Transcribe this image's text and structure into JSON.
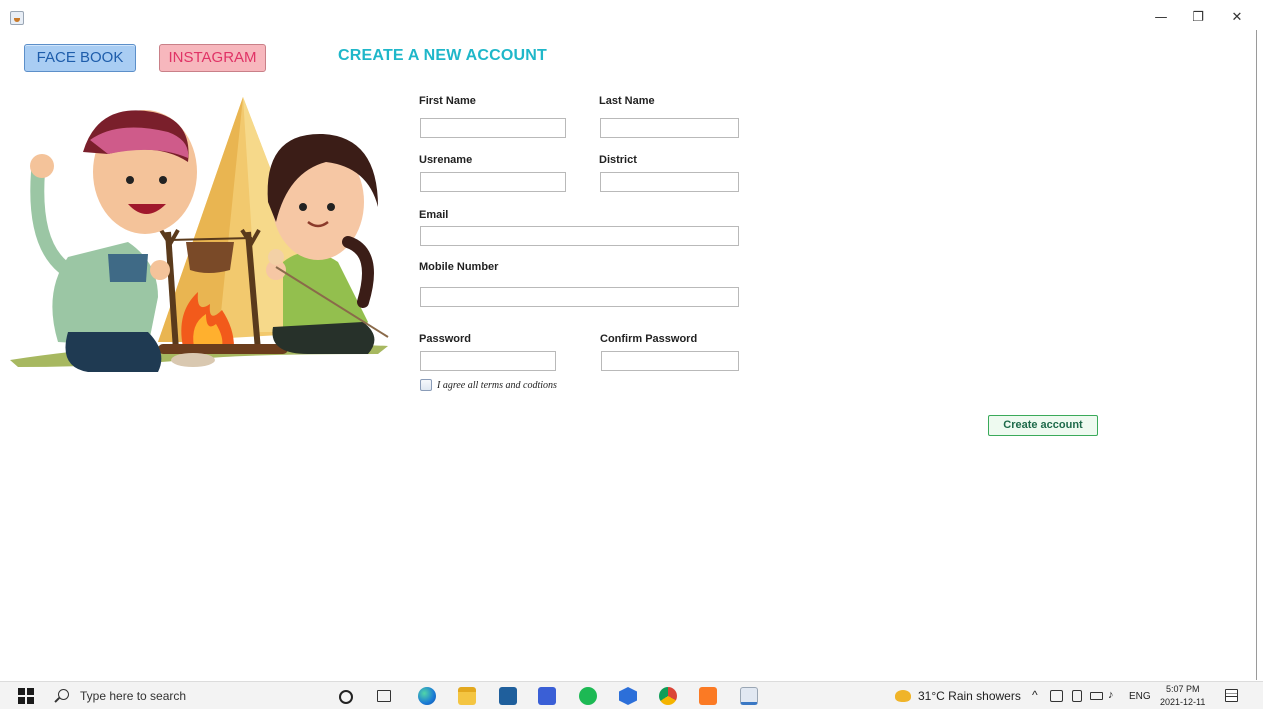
{
  "window": {
    "minimize_glyph": "—",
    "maximize_glyph": "❐",
    "close_glyph": "✕"
  },
  "nav": {
    "facebook_label": "FACE BOOK",
    "instagram_label": "INSTAGRAM"
  },
  "page_title": "CREATE A NEW ACCOUNT",
  "form": {
    "first_name_label": "First Name",
    "last_name_label": "Last Name",
    "username_label": "Usrename",
    "district_label": "District",
    "email_label": "Email",
    "mobile_label": "Mobile Number",
    "password_label": "Password",
    "confirm_password_label": "Confirm Password",
    "first_name_value": "",
    "last_name_value": "",
    "username_value": "",
    "district_value": "",
    "email_value": "",
    "mobile_value": "",
    "password_value": "",
    "confirm_password_value": "",
    "terms_label": "I agree all terms and codtions",
    "terms_checked": false,
    "submit_label": "Create account"
  },
  "taskbar": {
    "search_placeholder": "Type here to search",
    "weather": "31°C  Rain showers",
    "language": "ENG",
    "time": "5:07 PM",
    "date": "2021-12-11",
    "pinned_icons": [
      "cortana-icon",
      "task-view-icon",
      "edge-icon",
      "file-explorer-icon",
      "mail-icon",
      "visual-studio-icon",
      "spotify-icon",
      "app-hex-icon",
      "chrome-icon",
      "xampp-icon",
      "java-icon"
    ]
  },
  "colors": {
    "title": "#1fb7c9",
    "facebook_bg": "#a9cdf3",
    "facebook_text": "#1e5dab",
    "instagram_bg": "#f7b7bd",
    "instagram_text": "#e03366",
    "create_border": "#3aaa5a"
  }
}
